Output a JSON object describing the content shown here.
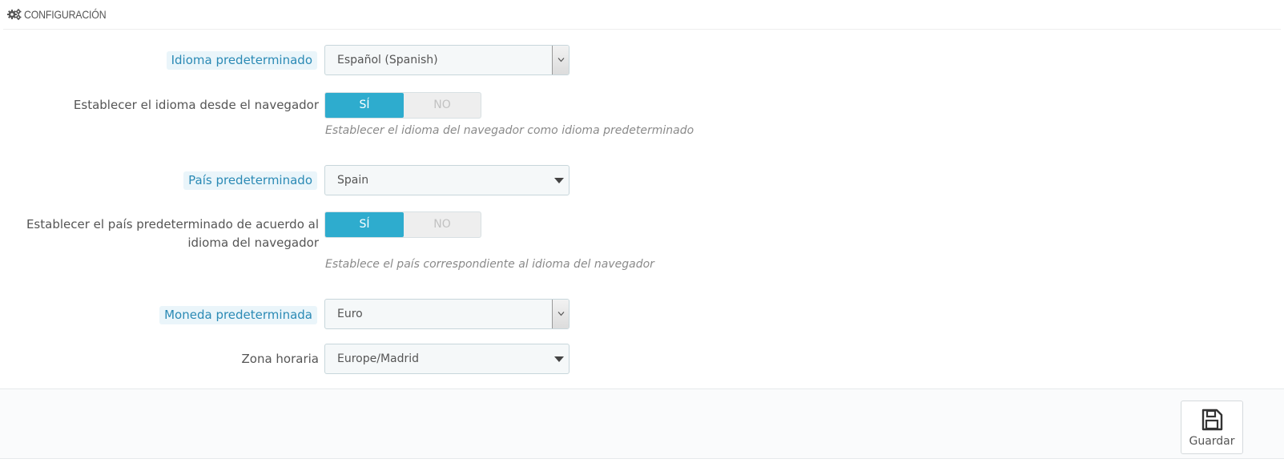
{
  "panel": {
    "title": "CONFIGURACIÓN",
    "icon": "gears-icon"
  },
  "fields": {
    "default_language": {
      "label": "Idioma predeterminado",
      "value": "Español (Spanish)"
    },
    "browser_language": {
      "label": "Establecer el idioma desde el navegador",
      "yes": "SÍ",
      "no": "NO",
      "selected": "yes",
      "help": "Establecer el idioma del navegador como idioma predeterminado"
    },
    "default_country": {
      "label": "País predeterminado",
      "value": "Spain"
    },
    "browser_country": {
      "label": "Establecer el país predeterminado de acuerdo al idioma del navegador",
      "yes": "SÍ",
      "no": "NO",
      "selected": "yes",
      "help": "Establece el país correspondiente al idioma del navegador"
    },
    "default_currency": {
      "label": "Moneda predeterminada",
      "value": "Euro"
    },
    "timezone": {
      "label": "Zona horaria",
      "value": "Europe/Madrid"
    }
  },
  "footer": {
    "save_label": "Guardar",
    "save_icon": "floppy-disk-icon"
  },
  "colors": {
    "accent": "#2eacce",
    "highlight_label_bg": "#eaf5fa",
    "highlight_label_text": "#2b8ab5"
  }
}
